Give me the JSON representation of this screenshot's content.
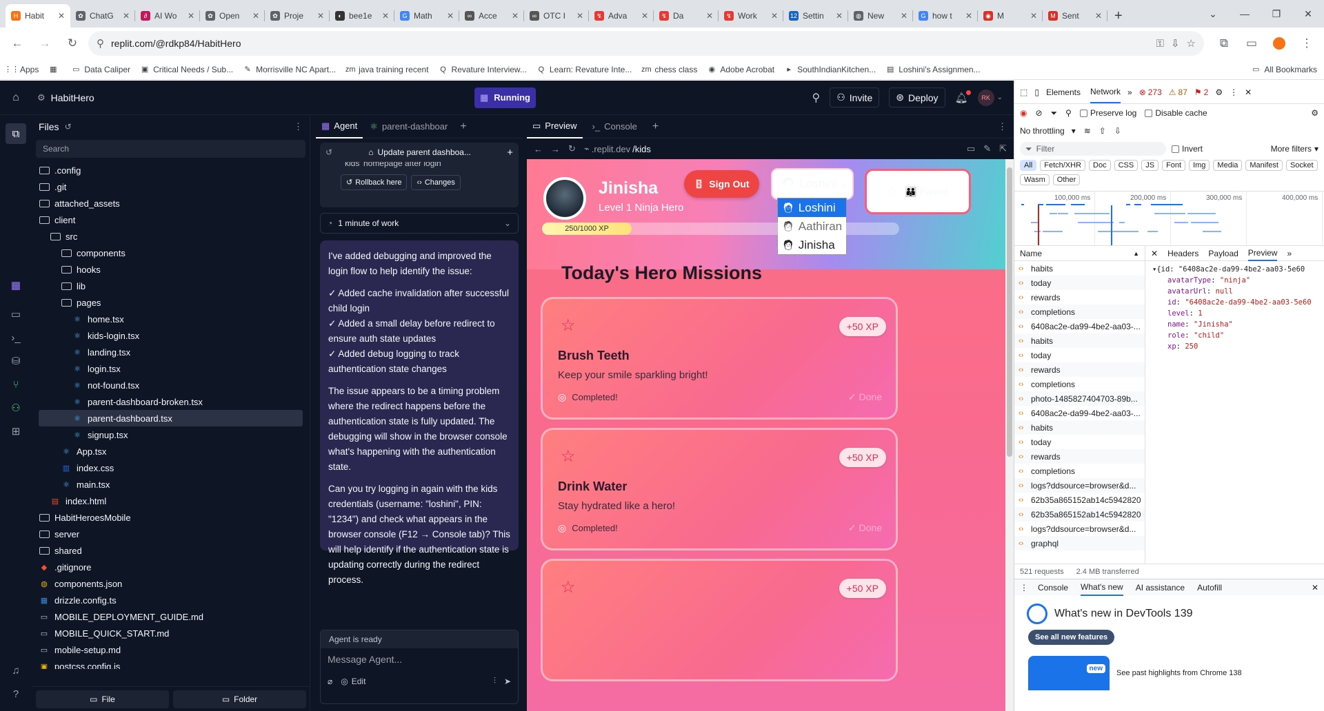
{
  "browser": {
    "tabs": [
      {
        "label": "Habit",
        "color": "#f97316",
        "glyph": "H"
      },
      {
        "label": "ChatG",
        "color": "#5f6368",
        "glyph": "✿"
      },
      {
        "label": "AI Wo",
        "color": "#c2185b",
        "glyph": "∂"
      },
      {
        "label": "Open",
        "color": "#5f6368",
        "glyph": "✿"
      },
      {
        "label": "Proje",
        "color": "#5f6368",
        "glyph": "✿"
      },
      {
        "label": "bee1e",
        "color": "#333",
        "glyph": "◐"
      },
      {
        "label": "Math",
        "color": "#4285f4",
        "glyph": "G"
      },
      {
        "label": "Acce",
        "color": "#555",
        "glyph": "∞"
      },
      {
        "label": "OTC I",
        "color": "#555",
        "glyph": "∞"
      },
      {
        "label": "Adva",
        "color": "#e53935",
        "glyph": "↯"
      },
      {
        "label": "Da",
        "color": "#e53935",
        "glyph": "↯"
      },
      {
        "label": "Work",
        "color": "#e53935",
        "glyph": "↯"
      },
      {
        "label": "Settin",
        "color": "#1565c0",
        "glyph": "12"
      },
      {
        "label": "New",
        "color": "#5f6368",
        "glyph": "◍"
      },
      {
        "label": "how t",
        "color": "#4285f4",
        "glyph": "G"
      },
      {
        "label": "M",
        "color": "#d93025",
        "glyph": "◉"
      },
      {
        "label": "Sent",
        "color": "#d93025",
        "glyph": "M"
      }
    ],
    "url": "replit.com/@rdkp84/HabitHero",
    "bookmarks": [
      {
        "label": "Apps",
        "glyph": "⋮⋮"
      },
      {
        "label": "",
        "glyph": "▦"
      },
      {
        "label": "Data Caliper",
        "glyph": "▭"
      },
      {
        "label": "Critical Needs / Sub...",
        "glyph": "▣"
      },
      {
        "label": "Morrisville NC Apart...",
        "glyph": "✎"
      },
      {
        "label": "java training recent",
        "glyph": "zm"
      },
      {
        "label": "Revature Interview...",
        "glyph": "Q"
      },
      {
        "label": "Learn: Revature Inte...",
        "glyph": "Q"
      },
      {
        "label": "chess class",
        "glyph": "zm"
      },
      {
        "label": "Adobe Acrobat",
        "glyph": "◉"
      },
      {
        "label": "SouthIndianKitchen...",
        "glyph": "▸"
      },
      {
        "label": "Loshini's Assignmen...",
        "glyph": "▤"
      }
    ],
    "all_bookmarks": "All Bookmarks"
  },
  "replit": {
    "project": "HabitHero",
    "status": "Running",
    "invite": "Invite",
    "deploy": "Deploy",
    "avatar": "RK",
    "files_title": "Files",
    "search_placeholder": "Search",
    "tree": [
      {
        "name": ".config",
        "type": "folder",
        "depth": 0
      },
      {
        "name": ".git",
        "type": "folder",
        "depth": 0
      },
      {
        "name": "attached_assets",
        "type": "folder",
        "depth": 0
      },
      {
        "name": "client",
        "type": "folder",
        "depth": 0
      },
      {
        "name": "src",
        "type": "folder",
        "depth": 1
      },
      {
        "name": "components",
        "type": "folder",
        "depth": 2
      },
      {
        "name": "hooks",
        "type": "folder",
        "depth": 2
      },
      {
        "name": "lib",
        "type": "folder",
        "depth": 2
      },
      {
        "name": "pages",
        "type": "folder",
        "depth": 2
      },
      {
        "name": "home.tsx",
        "type": "tsx",
        "depth": 3
      },
      {
        "name": "kids-login.tsx",
        "type": "tsx",
        "depth": 3
      },
      {
        "name": "landing.tsx",
        "type": "tsx",
        "depth": 3
      },
      {
        "name": "login.tsx",
        "type": "tsx",
        "depth": 3
      },
      {
        "name": "not-found.tsx",
        "type": "tsx",
        "depth": 3
      },
      {
        "name": "parent-dashboard-broken.tsx",
        "type": "tsx",
        "depth": 3
      },
      {
        "name": "parent-dashboard.tsx",
        "type": "tsx",
        "depth": 3,
        "selected": true
      },
      {
        "name": "signup.tsx",
        "type": "tsx",
        "depth": 3
      },
      {
        "name": "App.tsx",
        "type": "tsx",
        "depth": 2
      },
      {
        "name": "index.css",
        "type": "css",
        "depth": 2
      },
      {
        "name": "main.tsx",
        "type": "tsx",
        "depth": 2
      },
      {
        "name": "index.html",
        "type": "html",
        "depth": 1
      },
      {
        "name": "HabitHeroesMobile",
        "type": "folder",
        "depth": 0
      },
      {
        "name": "server",
        "type": "folder",
        "depth": 0
      },
      {
        "name": "shared",
        "type": "folder",
        "depth": 0
      },
      {
        "name": ".gitignore",
        "type": "git",
        "depth": 0
      },
      {
        "name": "components.json",
        "type": "json",
        "depth": 0
      },
      {
        "name": "drizzle.config.ts",
        "type": "ts",
        "depth": 0
      },
      {
        "name": "MOBILE_DEPLOYMENT_GUIDE.md",
        "type": "md",
        "depth": 0
      },
      {
        "name": "MOBILE_QUICK_START.md",
        "type": "md",
        "depth": 0
      },
      {
        "name": "mobile-setup.md",
        "type": "md",
        "depth": 0
      },
      {
        "name": "postcss.config.js",
        "type": "js",
        "depth": 0
      }
    ],
    "file_btn": "File",
    "folder_btn": "Folder",
    "agent": {
      "tab_agent": "Agent",
      "tab_file": "parent-dashboar",
      "thread_title": "Update parent dashboa...",
      "cut_text": "kids' homepage after login",
      "rollback": "Rollback here",
      "changes": "Changes",
      "work_time": "1 minute of work",
      "paragraphs": [
        "I've added debugging and improved the login flow to help identify the issue:",
        "✓ Added cache invalidation after successful child login\n✓ Added a small delay before redirect to ensure auth state updates\n✓ Added debug logging to track authentication state changes",
        "The issue appears to be a timing problem where the redirect happens before the authentication state is fully updated. The debugging will show in the browser console what's happening with the authentication state.",
        "Can you try logging in again with the kids credentials (username: \"loshini\", PIN: \"1234\") and check what appears in the browser console (F12 → Console tab)? This will help identify if the authentication state is updating correctly during the redirect process."
      ],
      "ready": "Agent is ready",
      "placeholder": "Message Agent...",
      "edit": "Edit"
    },
    "preview": {
      "tab_preview": "Preview",
      "tab_console": "Console",
      "url_prefix": ".replit.dev",
      "url_path": "/kids",
      "hero_name": "Jinisha",
      "hero_level": "Level 1 Ninja Hero",
      "sign_out": "Sign Out",
      "selected_kid": "Loshini",
      "kids": [
        "Loshini",
        "Aathiran",
        "Jinisha"
      ],
      "parent_btn": "👪 Parent",
      "xp_text": "250/1000 XP",
      "xp_fraction": 0.25,
      "missions_title": "Today's Hero Missions",
      "missions": [
        {
          "title": "Brush Teeth",
          "desc": "Keep your smile sparkling bright!",
          "xp": "+50 XP",
          "status": "Completed!",
          "done": "✓ Done"
        },
        {
          "title": "Drink Water",
          "desc": "Stay hydrated like a hero!",
          "xp": "+50 XP",
          "status": "Completed!",
          "done": "✓ Done"
        },
        {
          "title": "",
          "desc": "",
          "xp": "+50 XP",
          "status": "",
          "done": ""
        }
      ]
    }
  },
  "devtools": {
    "tabs": [
      "Elements",
      "Network"
    ],
    "errors": "273",
    "warnings": "87",
    "issues": "2",
    "preserve_log": "Preserve log",
    "disable_cache": "Disable cache",
    "throttling": "No throttling",
    "filter_placeholder": "Filter",
    "invert": "Invert",
    "more_filters": "More filters",
    "types": [
      "All",
      "Fetch/XHR",
      "Doc",
      "CSS",
      "JS",
      "Font",
      "Img",
      "Media",
      "Manifest",
      "Socket",
      "Wasm",
      "Other"
    ],
    "timeline_ticks": [
      "100,000 ms",
      "200,000 ms",
      "300,000 ms",
      "400,000 ms"
    ],
    "name_header": "Name",
    "detail_tabs": [
      "Headers",
      "Payload",
      "Preview"
    ],
    "requests": [
      "habits",
      "today",
      "rewards",
      "completions",
      "6408ac2e-da99-4be2-aa03-...",
      "habits",
      "today",
      "rewards",
      "completions",
      "photo-1485827404703-89b...",
      "6408ac2e-da99-4be2-aa03-...",
      "habits",
      "today",
      "rewards",
      "completions",
      "logs?ddsource=browser&d...",
      "62b35a865152ab14c5942820",
      "62b35a865152ab14c5942820",
      "logs?ddsource=browser&d...",
      "graphql"
    ],
    "preview_lines": [
      {
        "k": "",
        "v": "▾{id: \"6408ac2e-da99-4be2-aa03-5e60"
      },
      {
        "k": "avatarType",
        "v": "\"ninja\""
      },
      {
        "k": "avatarUrl",
        "v": "null"
      },
      {
        "k": "id",
        "v": "\"6408ac2e-da99-4be2-aa03-5e60"
      },
      {
        "k": "level",
        "v": "1"
      },
      {
        "k": "name",
        "v": "\"Jinisha\""
      },
      {
        "k": "role",
        "v": "\"child\""
      },
      {
        "k": "xp",
        "v": "250"
      }
    ],
    "footer_requests": "521 requests",
    "footer_transferred": "2.4 MB transferred",
    "drawer_tabs": [
      "Console",
      "What's new",
      "AI assistance",
      "Autofill"
    ],
    "whats_new_title": "What's new in DevTools 139",
    "see_all": "See all new features",
    "badge_new": "new",
    "past_highlights": "See past highlights from Chrome 138"
  },
  "colors": {
    "replit_bg": "#0e1525",
    "accent_purple": "#6e49ff",
    "hero_pink": "#f96a8f"
  }
}
